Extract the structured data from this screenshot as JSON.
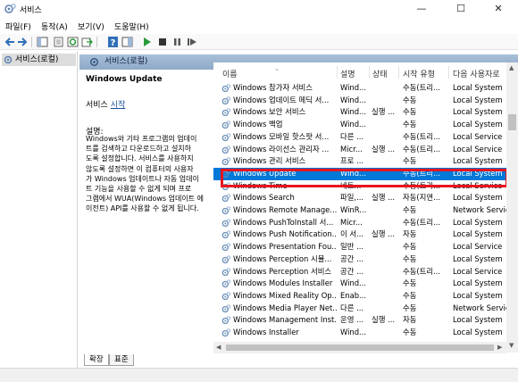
{
  "window": {
    "title": "서비스",
    "controls": {
      "minimize": "—",
      "maximize": "☐",
      "close": "✕"
    }
  },
  "menu": [
    "파일(F)",
    "동작(A)",
    "보기(V)",
    "도움말(H)"
  ],
  "toolbar": {
    "icons": [
      "back-arrow-icon",
      "forward-arrow-icon",
      "show-hide-tree-icon",
      "properties-icon",
      "refresh-icon",
      "export-list-icon",
      "help-icon",
      "show-pane-icon",
      "start-service-icon",
      "stop-service-icon",
      "pause-service-icon",
      "restart-service-icon"
    ]
  },
  "tree": {
    "selected_item": "서비스(로컬)"
  },
  "pane_header": "서비스(로컬)",
  "description": {
    "title": "Windows Update",
    "action_prefix": "서비스 ",
    "action_link": "시작",
    "label": "설명:",
    "body": "Windows와 기타 프로그램의 업데이\n트를 검색하고 다운로드하고 설치하\n도록 설정합니다. 서비스를 사용하지\n않도록 설정하면 이 컴퓨터의 사용자\n가 Windows 업데이트나 자동 업데이\n트 기능을 사용할 수 없게 되며 프로\n그램에서 WUA(Windows 업데이트 에\n이전트) API를 사용할 수 없게 됩니다."
  },
  "columns": [
    "이름",
    "설명",
    "상태",
    "시작 유형",
    "다음 사용자로"
  ],
  "services": [
    {
      "name": "Windows 참가자 서비스",
      "desc": "Wind...",
      "status": "",
      "startup": "수동(트리...",
      "logon": "Local System"
    },
    {
      "name": "Windows 업데이트 메딕 서...",
      "desc": "Wind...",
      "status": "",
      "startup": "수동",
      "logon": "Local System"
    },
    {
      "name": "Windows 보안 서비스",
      "desc": "Wind...",
      "status": "실행 ...",
      "startup": "수동",
      "logon": "Local System"
    },
    {
      "name": "Windows 백업",
      "desc": "Wind...",
      "status": "",
      "startup": "수동",
      "logon": "Local System"
    },
    {
      "name": "Windows 모바일 핫스팟 서...",
      "desc": "다른 ...",
      "status": "",
      "startup": "수동(트리...",
      "logon": "Local Service"
    },
    {
      "name": "Windows 라이선스 관리자 ...",
      "desc": "Micr...",
      "status": "실행 ...",
      "startup": "수동(트리...",
      "logon": "Local Service"
    },
    {
      "name": "Windows 관리 서비스",
      "desc": "프로 ...",
      "status": "",
      "startup": "수동",
      "logon": "Local System"
    },
    {
      "name": "Windows Update",
      "desc": "Wind...",
      "status": "",
      "startup": "수동(트리...",
      "logon": "Local System",
      "selected": true
    },
    {
      "name": "Windows Time",
      "desc": "네트...",
      "status": "",
      "startup": "수동(트리...",
      "logon": "Local Service"
    },
    {
      "name": "Windows Search",
      "desc": "파일,...",
      "status": "실행 ...",
      "startup": "자동(지연...",
      "logon": "Local System"
    },
    {
      "name": "Windows Remote Manage...",
      "desc": "WinR...",
      "status": "",
      "startup": "수동",
      "logon": "Network Service"
    },
    {
      "name": "Windows PushToInstall 서...",
      "desc": "Micr...",
      "status": "",
      "startup": "수동(트리...",
      "logon": "Local System"
    },
    {
      "name": "Windows Push Notification...",
      "desc": "이 서...",
      "status": "실행 ...",
      "startup": "자동",
      "logon": "Local System"
    },
    {
      "name": "Windows Presentation Fou...",
      "desc": "일반 ...",
      "status": "",
      "startup": "수동",
      "logon": "Local Service"
    },
    {
      "name": "Windows Perception 시뮬...",
      "desc": "공간 ...",
      "status": "",
      "startup": "수동",
      "logon": "Local System"
    },
    {
      "name": "Windows Perception 서비스",
      "desc": "공간 ...",
      "status": "",
      "startup": "수동(트리...",
      "logon": "Local Service"
    },
    {
      "name": "Windows Modules Installer",
      "desc": "Wind...",
      "status": "",
      "startup": "수동",
      "logon": "Local System"
    },
    {
      "name": "Windows Mixed Reality Op...",
      "desc": "Enab...",
      "status": "",
      "startup": "수동",
      "logon": "Local System"
    },
    {
      "name": "Windows Media Player Net...",
      "desc": "다른 ...",
      "status": "",
      "startup": "수동",
      "logon": "Network Service"
    },
    {
      "name": "Windows Management Inst...",
      "desc": "운영 ...",
      "status": "실행 ...",
      "startup": "자동",
      "logon": "Local System"
    },
    {
      "name": "Windows Installer",
      "desc": "Wind...",
      "status": "",
      "startup": "수동",
      "logon": "Local System"
    }
  ],
  "tabs": [
    "확장",
    "표준"
  ],
  "colors": {
    "selection": "#0078d7",
    "highlight_box": "#e8141e",
    "link": "#1c4ea2",
    "header_gradient_top": "#a9bfd8"
  }
}
